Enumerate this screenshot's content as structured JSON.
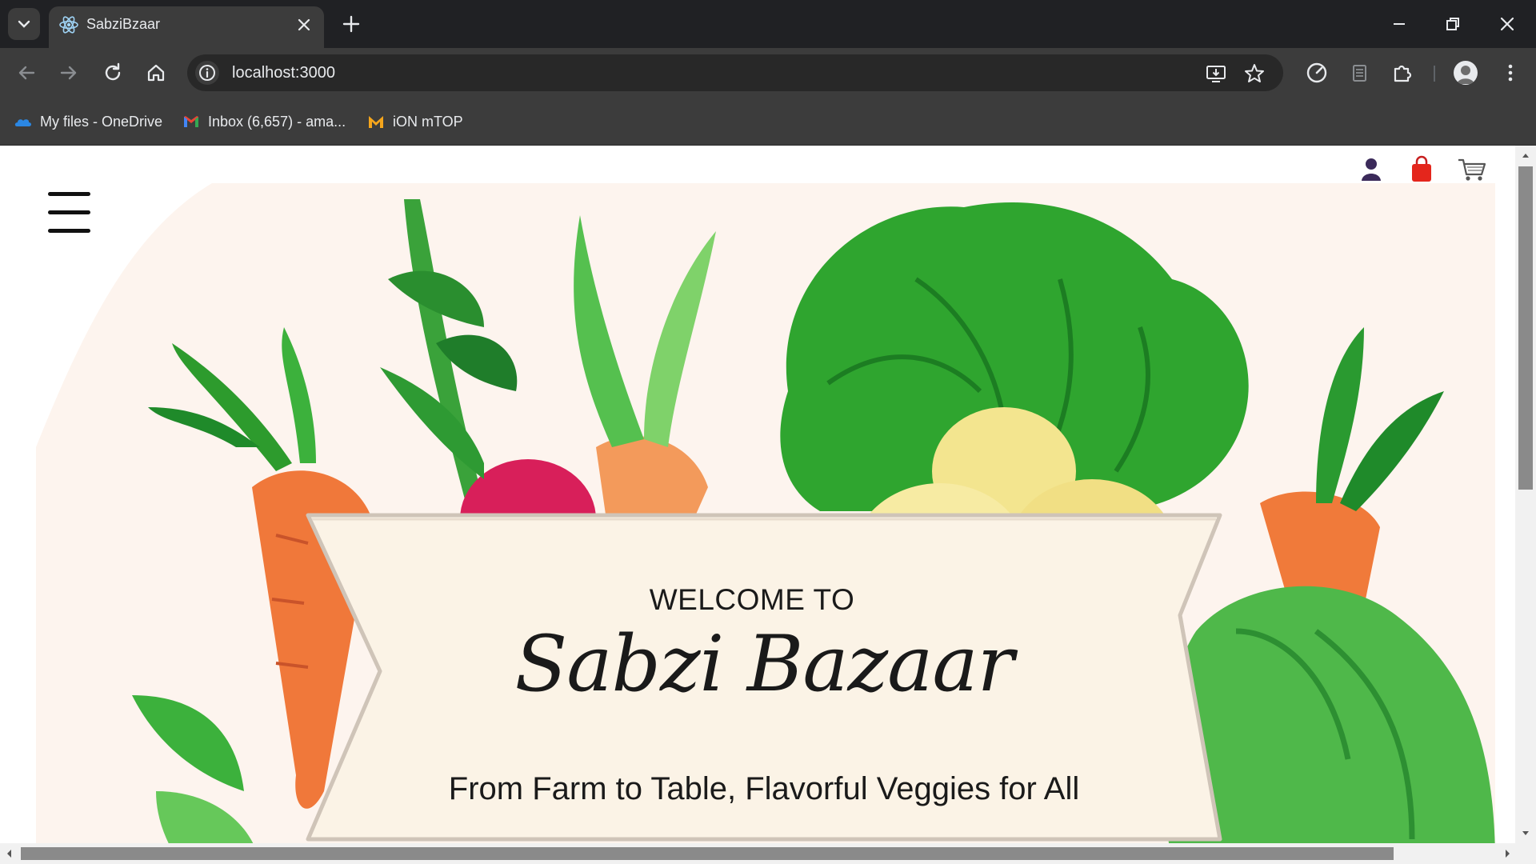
{
  "browser": {
    "tab": {
      "title": "SabziBzaar",
      "favicon": "react-atom-icon"
    },
    "address_bar": {
      "url": "localhost:3000"
    },
    "bookmarks": [
      {
        "label": "My files - OneDrive",
        "icon": "onedrive-cloud-icon"
      },
      {
        "label": "Inbox (6,657) - ama...",
        "icon": "gmail-icon"
      },
      {
        "label": "iON mTOP",
        "icon": "ion-mtop-icon"
      }
    ]
  },
  "page": {
    "header_icons": [
      "user-icon",
      "shopping-bag-icon",
      "cart-icon"
    ],
    "hero": {
      "welcome": "WELCOME TO",
      "brand": "Sabzi Bazaar",
      "tagline": "From Farm to Table, Flavorful Veggies for All"
    }
  },
  "colors": {
    "chrome_dark": "#202124",
    "chrome_toolbar": "#3c3c3c",
    "hero_background": "#fbeee6",
    "leaf_green": "#2fa52f",
    "carrot_orange": "#f07a3a",
    "radish_pink": "#d81f5a",
    "potato_yellow": "#f3e58f"
  }
}
